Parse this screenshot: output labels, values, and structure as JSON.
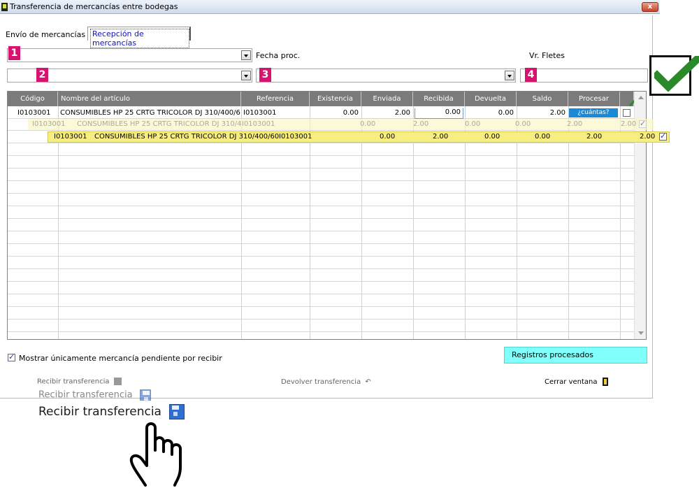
{
  "window": {
    "title": "Transferencia de mercancías entre bodegas",
    "close_label": "x"
  },
  "tabs": [
    {
      "label": "Envío de mercancías",
      "active": false
    },
    {
      "label": "Recepción de mercancías",
      "active": true
    }
  ],
  "filters": {
    "badge1": "1",
    "badge2": "2",
    "badge3": "3",
    "badge4": "4",
    "fecha_label": "Fecha proc.",
    "fletes_label": "Vr. Fletes"
  },
  "grid": {
    "columns": [
      "Código",
      "Nombre del artículo",
      "Referencia",
      "Existencia",
      "Enviada",
      "Recibida",
      "Devuelta",
      "Saldo",
      "Procesar",
      ""
    ],
    "row": {
      "codigo": "I0103001",
      "nombre": "CONSUMIBLES HP 25 CRTG TRICOLOR DJ 310/400/600",
      "referencia": "I0103001",
      "existencia": "0.00",
      "enviada": "2.00",
      "recibida": "0.00",
      "devuelta": "0.00",
      "saldo": "2.00",
      "procesar_button": "¿cuántas?"
    },
    "ghost_row": {
      "codigo": "I0103001",
      "nombre": "CONSUMIBLES HP 25 CRTG TRICOLOR DJ 310/400/600",
      "referencia": "I0103001",
      "existencia": "0.00",
      "enviada": "2.00",
      "recibida": "0.00",
      "devuelta": "0.00",
      "saldo": "2.00",
      "extra": "2.00"
    },
    "highlight_row": {
      "codigo": "I0103001",
      "nombre": "CONSUMIBLES HP 25 CRTG TRICOLOR DJ 310/400/600",
      "referencia": "I0103001",
      "existencia": "0.00",
      "enviada": "2.00",
      "recibida": "0.00",
      "devuelta": "0.00",
      "saldo": "2.00",
      "extra": "2.00"
    }
  },
  "footer": {
    "mostrar_label": "Mostrar únicamente mercancía pendiente por recibir",
    "mostrar_checked": true,
    "registros_label": "Registros procesados",
    "recibir_label": "Recibir transferencia",
    "devolver_label": "Devolver transferencia",
    "devolver_icon": "↶",
    "cerrar_label": "Cerrar ventana"
  },
  "overlay": {
    "mid_recibir_label": "Recibir transferencia",
    "big_recibir_label": "Recibir transferencia"
  },
  "colors": {
    "badge": "#d6136f",
    "highlight": "#f6ee80",
    "registros_bg": "#80fffb",
    "check_green": "#2a8a2a"
  },
  "icons": [
    "app-icon",
    "close-icon",
    "chevron-down-icon",
    "check-mark-icon",
    "arrow-icon",
    "save-icon",
    "undo-icon",
    "exit-door-icon",
    "hand-pointer-icon"
  ]
}
